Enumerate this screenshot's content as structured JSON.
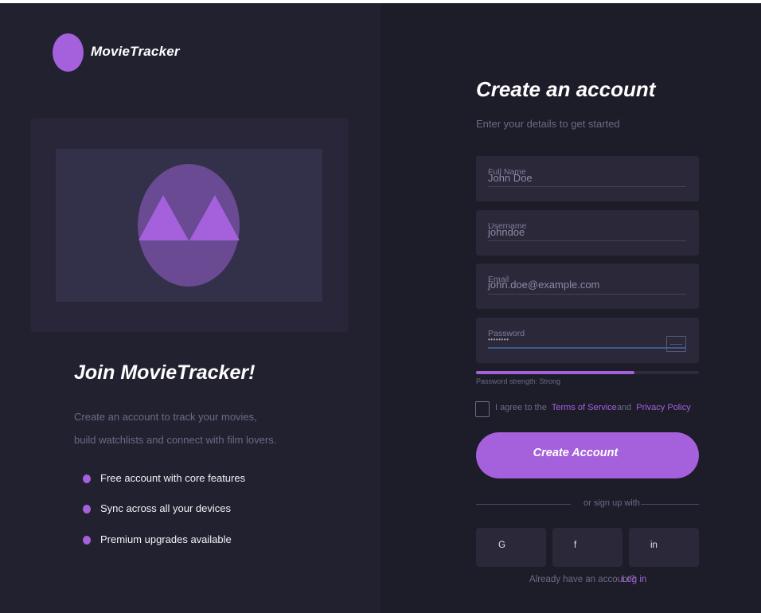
{
  "brand": {
    "name": "MovieTracker",
    "accent": "#a560dc"
  },
  "hero": {
    "title": "Join MovieTracker!",
    "description_line1": "Create an account to track your movies,",
    "description_line2": "build watchlists and connect with film lovers.",
    "illustration": "mountains-icon",
    "features": [
      "Free account with core features",
      "Sync across all your devices",
      "Premium upgrades available"
    ]
  },
  "form": {
    "title": "Create an account",
    "subtitle": "Enter your details to get started",
    "fields": {
      "full_name": {
        "label": "Full Name",
        "value": "John Doe"
      },
      "username": {
        "label": "Username",
        "value": "johndoe"
      },
      "email": {
        "label": "Email",
        "value": "john.doe@example.com"
      },
      "password": {
        "label": "Password",
        "value": "••••••••",
        "toggle_icon": "show-password-icon"
      }
    },
    "password_strength": {
      "label": "Password strength: Strong",
      "level": 0.71
    },
    "terms": {
      "prefix": "I agree to the",
      "terms_link": "Terms of Service",
      "and": "and",
      "privacy_link": "Privacy Policy",
      "checked": false
    },
    "submit_label": "Create Account",
    "divider_text": "or sign up with",
    "social": [
      {
        "label": "G",
        "icon": "google-icon"
      },
      {
        "label": "f",
        "icon": "facebook-icon"
      },
      {
        "label": "in",
        "icon": "linkedin-icon"
      }
    ],
    "login_prompt": "Already have an account?",
    "login_link": "Log in"
  }
}
